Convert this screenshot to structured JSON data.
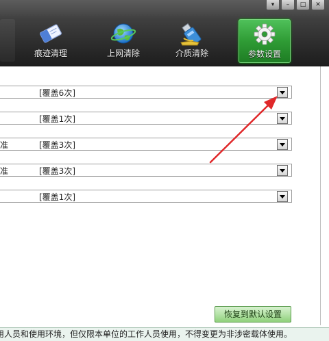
{
  "toolbar": {
    "tabs": [
      {
        "label": "痕迹清理",
        "icon": "eraser-icon"
      },
      {
        "label": "上网清除",
        "icon": "globe-icon"
      },
      {
        "label": "介质清除",
        "icon": "usb-drive-icon"
      },
      {
        "label": "参数设置",
        "icon": "gear-icon",
        "active": true
      }
    ],
    "window_buttons": [
      "menu",
      "minimize",
      "maximize",
      "close"
    ]
  },
  "settings": {
    "rows": [
      {
        "left_text": "",
        "value": "[覆盖6次]"
      },
      {
        "left_text": "",
        "value": "[覆盖1次]"
      },
      {
        "left_text": "准",
        "value": "[覆盖3次]"
      },
      {
        "left_text": "准",
        "value": "[覆盖3次]"
      },
      {
        "left_text": "",
        "value": "[覆盖1次]"
      }
    ]
  },
  "restore_button_label": "恢复到默认设置",
  "footer_text": "用人员和使用环境，但仅限本单位的工作人员使用，不得变更为非涉密载体使用。",
  "colors": {
    "active_tab": "#2f9c35",
    "annotation_arrow": "#e0282a",
    "toolbar_bg": "#2b2b2b"
  }
}
